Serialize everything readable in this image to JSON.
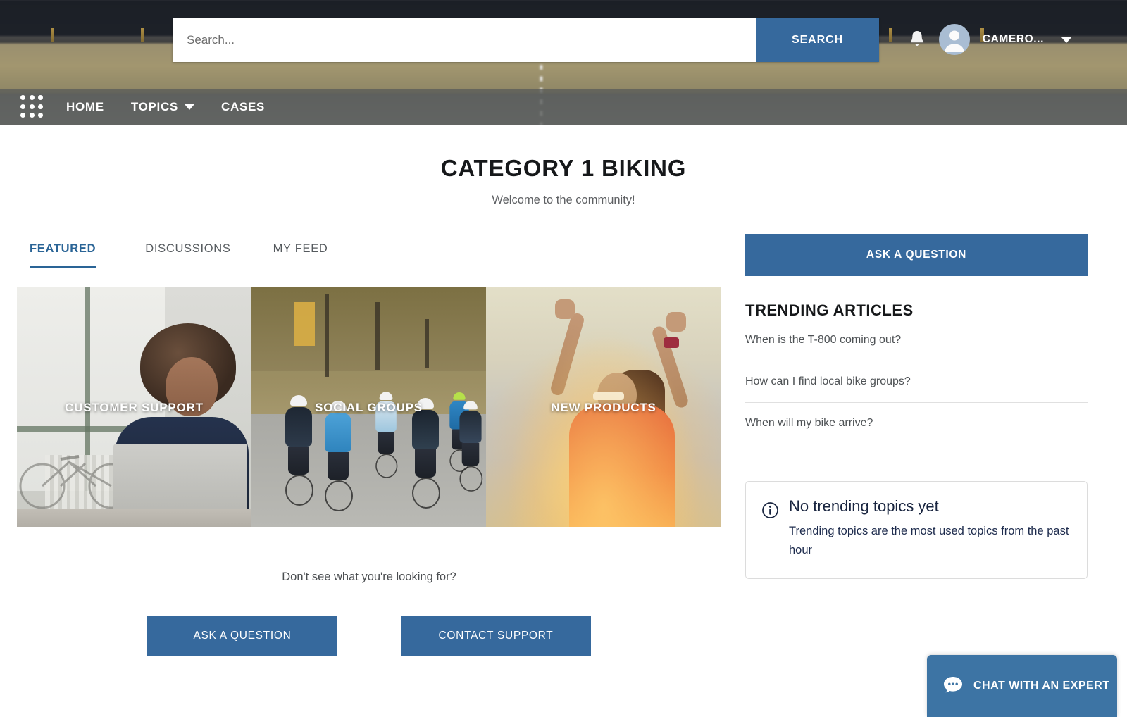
{
  "header": {
    "search": {
      "placeholder": "Search...",
      "value": "",
      "button_label": "SEARCH"
    },
    "notifications_icon": "bell-icon",
    "avatar_icon": "user-avatar-icon",
    "user_name": "CAMERO...",
    "user_menu_icon": "caret-down-icon"
  },
  "nav": {
    "app_launcher_icon": "app-launcher-waffle-icon",
    "items": [
      {
        "label": "HOME",
        "has_dropdown": false
      },
      {
        "label": "TOPICS",
        "has_dropdown": true
      },
      {
        "label": "CASES",
        "has_dropdown": false
      }
    ]
  },
  "page": {
    "title": "CATEGORY 1 BIKING",
    "subtitle": "Welcome to the community!"
  },
  "tabs": [
    {
      "label": "FEATURED",
      "active": true
    },
    {
      "label": "DISCUSSIONS",
      "active": false
    },
    {
      "label": "MY FEED",
      "active": false
    }
  ],
  "featured_cards": [
    {
      "label": "CUSTOMER SUPPORT"
    },
    {
      "label": "SOCIAL GROUPS"
    },
    {
      "label": "NEW PRODUCTS"
    }
  ],
  "cta": {
    "note": "Don't see what you're looking for?",
    "ask_label": "ASK A QUESTION",
    "contact_label": "CONTACT SUPPORT"
  },
  "sidebar": {
    "ask_label": "ASK A QUESTION",
    "trending_heading": "TRENDING ARTICLES",
    "articles": [
      "When is the T-800 coming out?",
      "How can I find local bike groups?",
      "When will my bike arrive?"
    ],
    "info": {
      "icon": "info-circle-icon",
      "title": "No trending topics yet",
      "body": "Trending topics are the most used topics from the past hour"
    }
  },
  "chat": {
    "icon": "chat-bubble-icon",
    "label": "CHAT WITH AN EXPERT"
  },
  "colors": {
    "accent_blue": "#36699d",
    "chat_blue": "#3d74a4",
    "tab_active": "#2a6496",
    "info_navy": "#1d2b4d",
    "nav_overlay": "rgba(90,93,90,0.80)"
  }
}
